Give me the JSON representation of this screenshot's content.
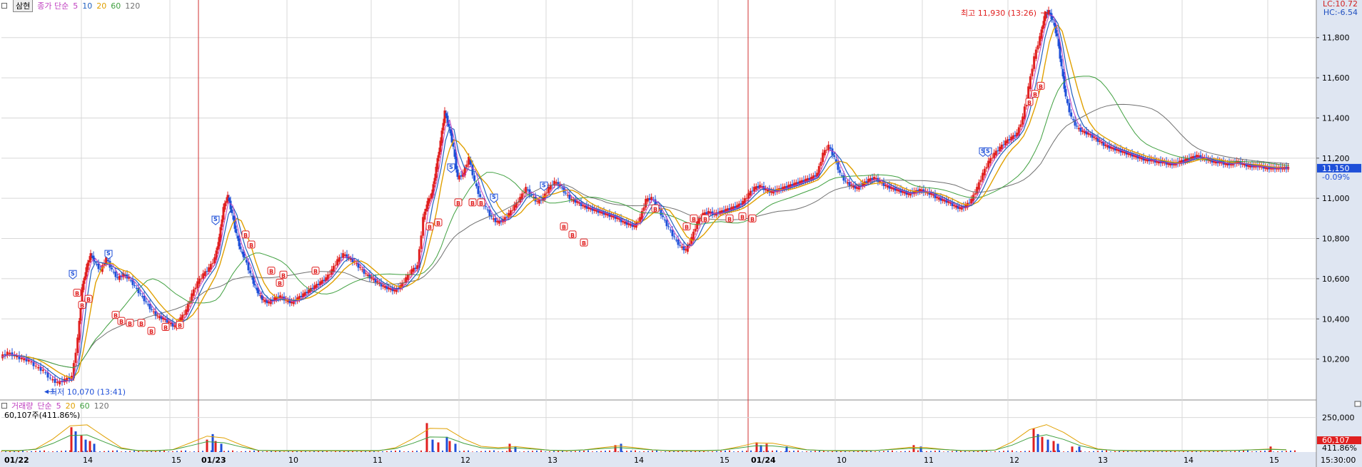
{
  "header": {
    "stock_name": "삼현",
    "price_label": "종가 단순",
    "ma_periods": [
      "5",
      "10",
      "20",
      "60",
      "120"
    ],
    "corner_lc": "LC:10.72",
    "corner_hc": "HC:-6.54"
  },
  "volume_header": {
    "label": "거래량",
    "ma_label": "단순",
    "ma_periods": [
      "5",
      "20",
      "60",
      "120"
    ],
    "current_value": "60,107주(411.86%)"
  },
  "colors": {
    "up": "#e02020",
    "down": "#1e4fd8",
    "ma5": "#c040c0",
    "ma10": "#2060c0",
    "ma20": "#e0a000",
    "ma60": "#40a040",
    "ma120": "#707070",
    "grid": "#d8d8d8",
    "axis_bg": "#dfe6f2",
    "session_line": "#d03030"
  },
  "chart_data": [
    {
      "type": "line",
      "name": "price",
      "ylim": [
        10000,
        11980
      ],
      "y_ticks": [
        "10,200",
        "10,400",
        "10,600",
        "10,800",
        "11,000",
        "11,200",
        "11,400",
        "11,600",
        "11,800"
      ],
      "x_tick_labels": [
        "01/22",
        "14",
        "15",
        "01/23",
        "10",
        "11",
        "12",
        "13",
        "14",
        "15",
        "01/24",
        "10",
        "11",
        "12",
        "13",
        "14",
        "15",
        "15:30:00"
      ],
      "x_tick_bold": [
        "01/22",
        "01/23",
        "01/24"
      ],
      "price_points": [
        [
          0,
          10210
        ],
        [
          10,
          10230
        ],
        [
          20,
          10215
        ],
        [
          30,
          10200
        ],
        [
          40,
          10190
        ],
        [
          50,
          10160
        ],
        [
          60,
          10140
        ],
        [
          70,
          10100
        ],
        [
          80,
          10080
        ],
        [
          90,
          10095
        ],
        [
          100,
          10110
        ],
        [
          108,
          10300
        ],
        [
          114,
          10550
        ],
        [
          120,
          10650
        ],
        [
          126,
          10720
        ],
        [
          132,
          10680
        ],
        [
          140,
          10640
        ],
        [
          148,
          10700
        ],
        [
          156,
          10640
        ],
        [
          164,
          10600
        ],
        [
          172,
          10620
        ],
        [
          180,
          10600
        ],
        [
          188,
          10560
        ],
        [
          196,
          10520
        ],
        [
          204,
          10480
        ],
        [
          212,
          10440
        ],
        [
          220,
          10410
        ],
        [
          228,
          10400
        ],
        [
          236,
          10380
        ],
        [
          244,
          10360
        ],
        [
          252,
          10400
        ],
        [
          260,
          10440
        ],
        [
          268,
          10520
        ],
        [
          276,
          10580
        ],
        [
          284,
          10620
        ],
        [
          292,
          10650
        ],
        [
          300,
          10700
        ],
        [
          306,
          10800
        ],
        [
          312,
          10950
        ],
        [
          318,
          11010
        ],
        [
          324,
          10920
        ],
        [
          330,
          10820
        ],
        [
          336,
          10740
        ],
        [
          342,
          10700
        ],
        [
          350,
          10620
        ],
        [
          356,
          10560
        ],
        [
          362,
          10520
        ],
        [
          368,
          10490
        ],
        [
          376,
          10480
        ],
        [
          384,
          10500
        ],
        [
          392,
          10510
        ],
        [
          400,
          10490
        ],
        [
          408,
          10480
        ],
        [
          416,
          10500
        ],
        [
          424,
          10520
        ],
        [
          432,
          10540
        ],
        [
          440,
          10560
        ],
        [
          448,
          10580
        ],
        [
          456,
          10600
        ],
        [
          464,
          10640
        ],
        [
          472,
          10690
        ],
        [
          480,
          10720
        ],
        [
          488,
          10700
        ],
        [
          496,
          10680
        ],
        [
          504,
          10650
        ],
        [
          512,
          10620
        ],
        [
          520,
          10600
        ],
        [
          528,
          10580
        ],
        [
          536,
          10560
        ],
        [
          544,
          10550
        ],
        [
          552,
          10540
        ],
        [
          560,
          10560
        ],
        [
          568,
          10600
        ],
        [
          576,
          10640
        ],
        [
          584,
          10660
        ],
        [
          592,
          10900
        ],
        [
          598,
          10980
        ],
        [
          604,
          11020
        ],
        [
          610,
          11150
        ],
        [
          616,
          11280
        ],
        [
          622,
          11430
        ],
        [
          628,
          11350
        ],
        [
          634,
          11250
        ],
        [
          640,
          11100
        ],
        [
          648,
          11120
        ],
        [
          656,
          11200
        ],
        [
          664,
          11080
        ],
        [
          672,
          11000
        ],
        [
          680,
          10950
        ],
        [
          688,
          10900
        ],
        [
          696,
          10880
        ],
        [
          704,
          10890
        ],
        [
          712,
          10920
        ],
        [
          720,
          10960
        ],
        [
          728,
          11000
        ],
        [
          736,
          11050
        ],
        [
          744,
          11010
        ],
        [
          752,
          10980
        ],
        [
          760,
          11000
        ],
        [
          768,
          11050
        ],
        [
          776,
          11080
        ],
        [
          784,
          11060
        ],
        [
          792,
          11020
        ],
        [
          800,
          10990
        ],
        [
          808,
          10980
        ],
        [
          816,
          10960
        ],
        [
          824,
          10950
        ],
        [
          832,
          10940
        ],
        [
          840,
          10930
        ],
        [
          848,
          10920
        ],
        [
          856,
          10910
        ],
        [
          864,
          10900
        ],
        [
          872,
          10880
        ],
        [
          880,
          10870
        ],
        [
          888,
          10860
        ],
        [
          896,
          10900
        ],
        [
          904,
          10990
        ],
        [
          912,
          11000
        ],
        [
          920,
          10960
        ],
        [
          928,
          10900
        ],
        [
          936,
          10850
        ],
        [
          944,
          10800
        ],
        [
          952,
          10760
        ],
        [
          960,
          10740
        ],
        [
          968,
          10800
        ],
        [
          976,
          10880
        ],
        [
          984,
          10920
        ],
        [
          992,
          10930
        ],
        [
          1000,
          10920
        ],
        [
          1008,
          10930
        ],
        [
          1016,
          10940
        ],
        [
          1024,
          10950
        ],
        [
          1032,
          10960
        ],
        [
          1040,
          10980
        ],
        [
          1048,
          11020
        ],
        [
          1056,
          11050
        ],
        [
          1064,
          11060
        ],
        [
          1072,
          11040
        ],
        [
          1080,
          11030
        ],
        [
          1088,
          11040
        ],
        [
          1096,
          11050
        ],
        [
          1104,
          11060
        ],
        [
          1112,
          11070
        ],
        [
          1120,
          11080
        ],
        [
          1128,
          11090
        ],
        [
          1136,
          11100
        ],
        [
          1144,
          11120
        ],
        [
          1152,
          11220
        ],
        [
          1160,
          11260
        ],
        [
          1168,
          11200
        ],
        [
          1176,
          11120
        ],
        [
          1184,
          11080
        ],
        [
          1192,
          11060
        ],
        [
          1200,
          11050
        ],
        [
          1208,
          11070
        ],
        [
          1216,
          11090
        ],
        [
          1224,
          11100
        ],
        [
          1232,
          11080
        ],
        [
          1240,
          11060
        ],
        [
          1248,
          11050
        ],
        [
          1256,
          11040
        ],
        [
          1264,
          11030
        ],
        [
          1272,
          11020
        ],
        [
          1280,
          11030
        ],
        [
          1288,
          11040
        ],
        [
          1296,
          11030
        ],
        [
          1304,
          11020
        ],
        [
          1312,
          11000
        ],
        [
          1320,
          10990
        ],
        [
          1328,
          10980
        ],
        [
          1336,
          10960
        ],
        [
          1344,
          10950
        ],
        [
          1352,
          10960
        ],
        [
          1360,
          10990
        ],
        [
          1368,
          11050
        ],
        [
          1376,
          11120
        ],
        [
          1384,
          11180
        ],
        [
          1392,
          11220
        ],
        [
          1400,
          11250
        ],
        [
          1408,
          11280
        ],
        [
          1416,
          11300
        ],
        [
          1424,
          11320
        ],
        [
          1432,
          11400
        ],
        [
          1440,
          11550
        ],
        [
          1448,
          11700
        ],
        [
          1456,
          11800
        ],
        [
          1462,
          11900
        ],
        [
          1468,
          11930
        ],
        [
          1474,
          11880
        ],
        [
          1480,
          11800
        ],
        [
          1486,
          11650
        ],
        [
          1492,
          11500
        ],
        [
          1500,
          11400
        ],
        [
          1508,
          11350
        ],
        [
          1516,
          11330
        ],
        [
          1524,
          11320
        ],
        [
          1532,
          11300
        ],
        [
          1540,
          11280
        ],
        [
          1548,
          11260
        ],
        [
          1556,
          11250
        ],
        [
          1564,
          11240
        ],
        [
          1572,
          11230
        ],
        [
          1580,
          11220
        ],
        [
          1588,
          11210
        ],
        [
          1596,
          11200
        ],
        [
          1604,
          11190
        ],
        [
          1612,
          11190
        ],
        [
          1620,
          11180
        ],
        [
          1628,
          11180
        ],
        [
          1636,
          11170
        ],
        [
          1644,
          11170
        ],
        [
          1652,
          11180
        ],
        [
          1660,
          11190
        ],
        [
          1668,
          11200
        ],
        [
          1676,
          11210
        ],
        [
          1684,
          11200
        ],
        [
          1692,
          11190
        ],
        [
          1700,
          11180
        ],
        [
          1708,
          11180
        ],
        [
          1716,
          11170
        ],
        [
          1724,
          11170
        ],
        [
          1732,
          11180
        ],
        [
          1740,
          11170
        ],
        [
          1748,
          11160
        ],
        [
          1756,
          11160
        ],
        [
          1764,
          11160
        ],
        [
          1772,
          11150
        ],
        [
          1780,
          11150
        ],
        [
          1788,
          11150
        ],
        [
          1796,
          11150
        ],
        [
          1804,
          11150
        ]
      ],
      "last_price": "11,150",
      "last_change": "-0.09%",
      "max_annotation": "최고 11,930 (13:26)",
      "min_annotation": "최저 10,070 (13:41)",
      "signals_s": [
        [
          100,
          10620
        ],
        [
          150,
          10720
        ],
        [
          300,
          10890
        ],
        [
          630,
          11150
        ],
        [
          690,
          11000
        ],
        [
          760,
          11060
        ],
        [
          1375,
          11230
        ],
        [
          1382,
          11230
        ]
      ],
      "signals_b": [
        [
          106,
          10530
        ],
        [
          113,
          10470
        ],
        [
          122,
          10500
        ],
        [
          160,
          10420
        ],
        [
          168,
          10390
        ],
        [
          180,
          10380
        ],
        [
          196,
          10380
        ],
        [
          210,
          10340
        ],
        [
          230,
          10360
        ],
        [
          250,
          10370
        ],
        [
          342,
          10820
        ],
        [
          350,
          10770
        ],
        [
          378,
          10640
        ],
        [
          390,
          10580
        ],
        [
          395,
          10620
        ],
        [
          440,
          10640
        ],
        [
          600,
          10860
        ],
        [
          612,
          10880
        ],
        [
          640,
          10980
        ],
        [
          660,
          10980
        ],
        [
          672,
          10980
        ],
        [
          788,
          10860
        ],
        [
          800,
          10820
        ],
        [
          816,
          10780
        ],
        [
          916,
          10950
        ],
        [
          960,
          10860
        ],
        [
          970,
          10900
        ],
        [
          986,
          10900
        ],
        [
          1020,
          10900
        ],
        [
          1038,
          10910
        ],
        [
          1052,
          10900
        ],
        [
          1440,
          11480
        ],
        [
          1448,
          11520
        ],
        [
          1456,
          11560
        ]
      ]
    },
    {
      "type": "bar",
      "name": "volume",
      "ylim": [
        0,
        300000
      ],
      "y_ticks": [
        "250,000"
      ],
      "current_volume": "60,107",
      "current_pct": "411.86%",
      "volume_spikes": [
        [
          98,
          180000
        ],
        [
          104,
          150000
        ],
        [
          112,
          120000
        ],
        [
          118,
          90000
        ],
        [
          124,
          80000
        ],
        [
          130,
          60000
        ],
        [
          288,
          90000
        ],
        [
          296,
          130000
        ],
        [
          300,
          80000
        ],
        [
          308,
          60000
        ],
        [
          596,
          210000
        ],
        [
          604,
          90000
        ],
        [
          612,
          70000
        ],
        [
          624,
          110000
        ],
        [
          628,
          80000
        ],
        [
          636,
          60000
        ],
        [
          712,
          60000
        ],
        [
          720,
          40000
        ],
        [
          860,
          50000
        ],
        [
          868,
          60000
        ],
        [
          1058,
          70000
        ],
        [
          1064,
          50000
        ],
        [
          1072,
          60000
        ],
        [
          1100,
          40000
        ],
        [
          1278,
          50000
        ],
        [
          1288,
          40000
        ],
        [
          1446,
          170000
        ],
        [
          1452,
          130000
        ],
        [
          1458,
          110000
        ],
        [
          1466,
          90000
        ],
        [
          1474,
          80000
        ],
        [
          1480,
          60000
        ],
        [
          1500,
          40000
        ],
        [
          1510,
          40000
        ],
        [
          1778,
          40000
        ]
      ]
    }
  ]
}
